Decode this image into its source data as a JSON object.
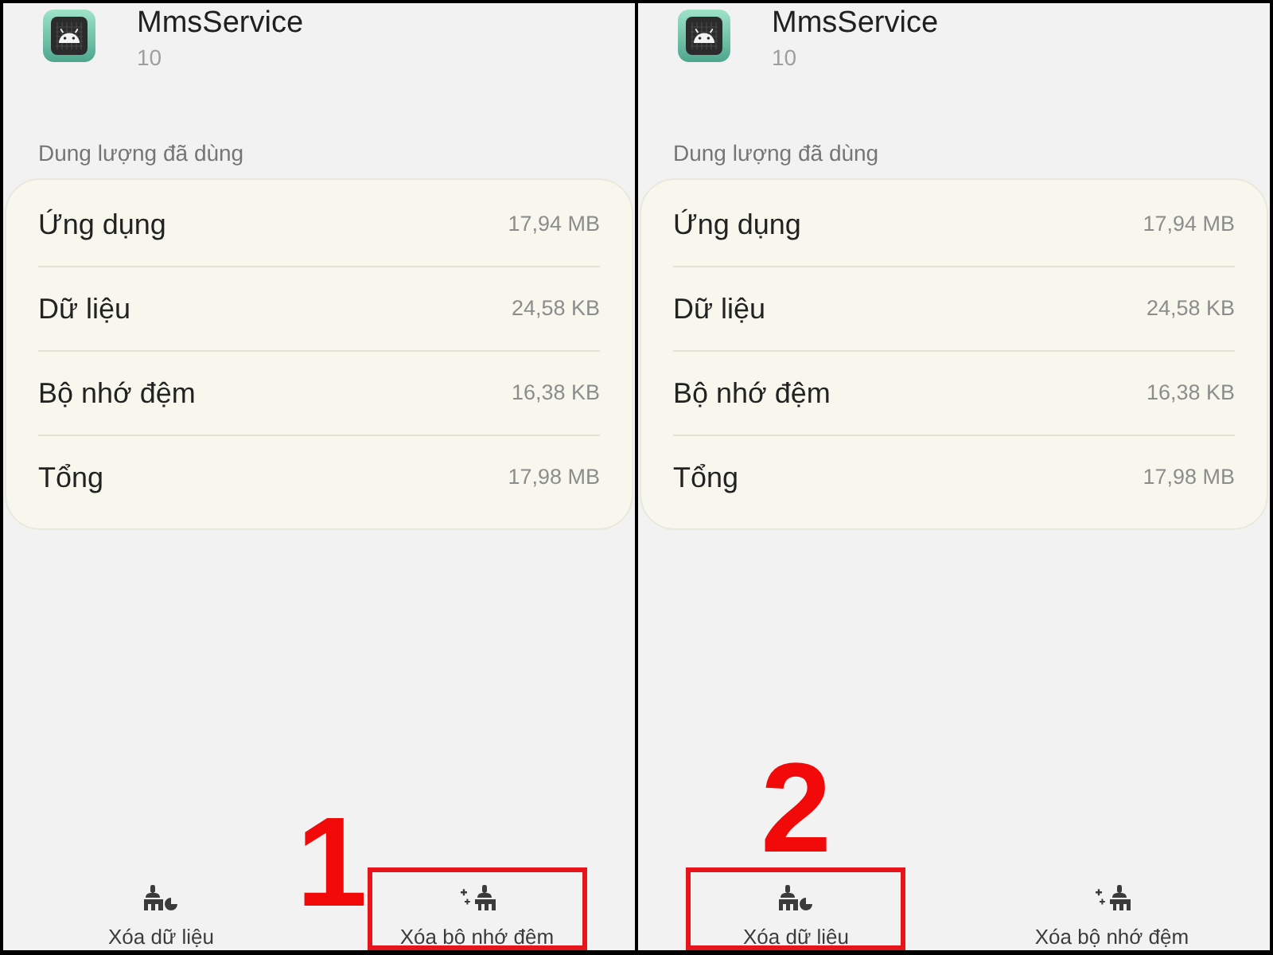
{
  "panels": [
    {
      "app": {
        "name": "MmsService",
        "version": "10"
      },
      "section_title": "Dung lượng đã dùng",
      "storage_rows": [
        {
          "label": "Ứng dụng",
          "value": "17,94 MB"
        },
        {
          "label": "Dữ liệu",
          "value": "24,58 KB"
        },
        {
          "label": "Bộ nhớ đệm",
          "value": "16,38 KB"
        },
        {
          "label": "Tổng",
          "value": "17,98 MB"
        }
      ],
      "actions": [
        {
          "kind": "clear-data",
          "label": "Xóa dữ liệu",
          "highlighted": false
        },
        {
          "kind": "clear-cache",
          "label": "Xóa bộ nhớ đệm",
          "highlighted": true,
          "step_number": "1",
          "step_beside": true
        }
      ]
    },
    {
      "app": {
        "name": "MmsService",
        "version": "10"
      },
      "section_title": "Dung lượng đã dùng",
      "storage_rows": [
        {
          "label": "Ứng dụng",
          "value": "17,94 MB"
        },
        {
          "label": "Dữ liệu",
          "value": "24,58 KB"
        },
        {
          "label": "Bộ nhớ đệm",
          "value": "16,38 KB"
        },
        {
          "label": "Tổng",
          "value": "17,98 MB"
        }
      ],
      "actions": [
        {
          "kind": "clear-data",
          "label": "Xóa dữ liệu",
          "highlighted": true,
          "step_number": "2",
          "step_beside": false
        },
        {
          "kind": "clear-cache",
          "label": "Xóa bộ nhớ đệm",
          "highlighted": false
        }
      ]
    }
  ]
}
